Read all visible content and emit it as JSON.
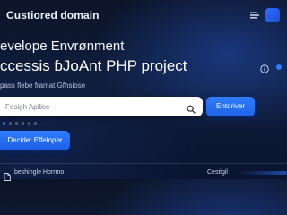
{
  "header": {
    "title": "Custiored domain",
    "menu_icon": "menu-icon",
    "avatar_color": "#2a6cff"
  },
  "hero": {
    "line1": "evelope Envrønment",
    "line2": "ccessis ɓJoAnt PHP project",
    "subtitle": "pass flebe framat  Gfhsiose",
    "info_icon": "info-icon",
    "status_dot_color": "#2f7bff"
  },
  "search": {
    "placeholder": "Fesigh Apilice",
    "value": "",
    "button_label": "Entdriver",
    "icon": "search-icon"
  },
  "pager": {
    "count": 6,
    "active_index": 0
  },
  "actions": {
    "secondary_label": "Decide: Effeloper"
  },
  "footer": {
    "left_icon": "file-icon",
    "left_label": "beshingle Horrmo",
    "right_label": "Cestigil"
  },
  "colors": {
    "accent": "#2f7bff",
    "background": "#0f1d3a",
    "button": "#1f62e6"
  }
}
